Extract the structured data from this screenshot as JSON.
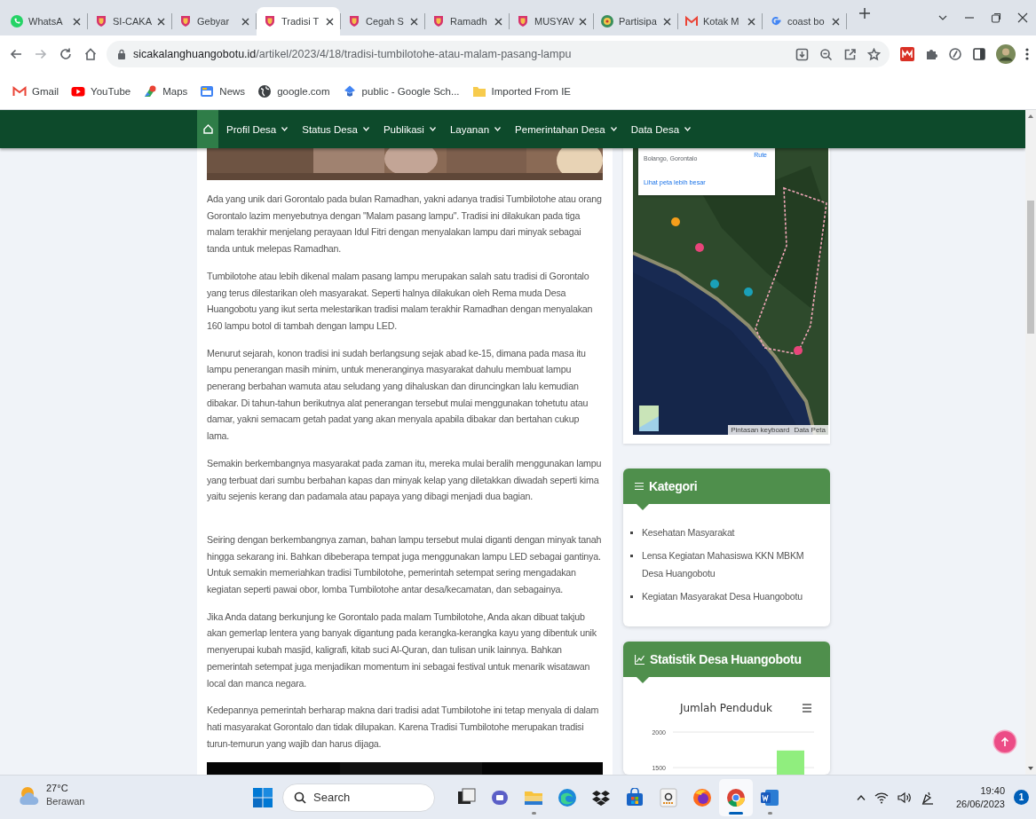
{
  "browser_tabs": [
    {
      "title": "WhatsA",
      "kind": "chat",
      "selected": false
    },
    {
      "title": "SI-CAKA",
      "kind": "crest",
      "selected": false
    },
    {
      "title": "Gebyar",
      "kind": "crest",
      "selected": false
    },
    {
      "title": "Tradisi T",
      "kind": "crest",
      "selected": true
    },
    {
      "title": "Cegah S",
      "kind": "crest",
      "selected": false
    },
    {
      "title": "Ramadh",
      "kind": "crest",
      "selected": false
    },
    {
      "title": "MUSYAV",
      "kind": "crest",
      "selected": false
    },
    {
      "title": "Partisipa",
      "kind": "emblem",
      "selected": false
    },
    {
      "title": "Kotak M",
      "kind": "mail",
      "selected": false
    },
    {
      "title": "coast bo",
      "kind": "search",
      "selected": false
    }
  ],
  "address_bar": {
    "url": "sicakalanghuangobotu.id/artikel/2023/4/18/tradisi-tumbilotohe-atau-malam-pasang-lampu"
  },
  "bookmarks": [
    {
      "label": "Gmail",
      "kind": "mail"
    },
    {
      "label": "YouTube",
      "kind": "video"
    },
    {
      "label": "Maps",
      "kind": "map"
    },
    {
      "label": "News",
      "kind": "news"
    },
    {
      "label": "google.com",
      "kind": "globe"
    },
    {
      "label": "public - Google Sch...",
      "kind": "cap"
    },
    {
      "label": "Imported From IE",
      "kind": "folder"
    }
  ],
  "site_nav": {
    "items": [
      {
        "label": "Profil Desa"
      },
      {
        "label": "Status Desa"
      },
      {
        "label": "Publikasi"
      },
      {
        "label": "Layanan"
      },
      {
        "label": "Pemerintahan Desa"
      },
      {
        "label": "Data Desa"
      }
    ]
  },
  "article": {
    "paragraphs": [
      {
        "text": "Ada yang unik dari Gorontalo pada bulan Ramadhan, yakni adanya tradisi Tumbilotohe atau orang Gorontalo lazim menyebutnya dengan \"Malam pasang lampu\". Tradisi ini dilakukan pada tiga malam terakhir menjelang perayaan Idul Fitri dengan menyalakan lampu dari minyak sebagai tanda untuk melepas Ramadhan.",
        "gap_before": false
      },
      {
        "text": "Tumbilotohe atau lebih dikenal malam pasang lampu merupakan salah satu tradisi di Gorontalo yang terus dilestarikan oleh masyarakat. Seperti halnya dilakukan oleh Rema muda Desa Huangobotu yang ikut serta melestarikan tradisi malam terakhir Ramadhan dengan menyalakan 160 lampu botol di tambah dengan lampu LED.",
        "gap_before": false
      },
      {
        "text": "Menurut sejarah, konon tradisi ini sudah berlangsung sejak abad ke-15, dimana pada masa itu lampu penerangan masih minim, untuk meneranginya masyarakat dahulu membuat lampu penerang berbahan wamuta atau seludang yang dihaluskan dan diruncingkan lalu kemudian dibakar. Di tahun-tahun berikutnya alat penerangan tersebut mulai menggunakan tohetutu atau damar, yakni semacam getah padat yang akan menyala apabila dibakar dan bertahan cukup lama.",
        "gap_before": false
      },
      {
        "text": "Semakin berkembangnya masyarakat pada zaman itu, mereka mulai beralih menggunakan lampu yang terbuat dari sumbu berbahan kapas dan minyak kelap yang diletakkan diwadah seperti kima yaitu sejenis kerang dan padamala atau papaya yang dibagi menjadi dua bagian.",
        "gap_before": false
      },
      {
        "text": "Seiring dengan berkembangnya zaman, bahan lampu tersebut mulai diganti dengan minyak tanah hingga sekarang ini. Bahkan dibeberapa tempat juga menggunakan lampu LED sebagai gantinya. Untuk semakin memeriahkan tradisi Tumbilotohe, pemerintah setempat sering mengadakan kegiatan seperti pawai obor, lomba Tumbilotohe antar desa/kecamatan, dan sebagainya.",
        "gap_before": true
      },
      {
        "text": "Jika Anda datang berkunjung ke Gorontalo pada malam Tumbilotohe, Anda akan dibuat takjub akan gemerlap lentera yang banyak digantung pada kerangka-kerangka kayu yang dibentuk unik menyerupai kubah masjid, kaligrafi, kitab suci Al-Quran, dan tulisan unik lainnya. Bahkan pemerintah setempat juga menjadikan momentum ini sebagai festival untuk menarik wisatawan local dan manca negara.",
        "gap_before": false
      },
      {
        "text": "Kedepannya pemerintah berharap makna dari tradisi adat Tumbilotohe ini tetap menyala di dalam hati masyarakat Gorontalo dan tidak dilupakan. Karena Tradisi Tumbilotohe merupakan tradisi turun-temurun yang wajib dan harus dijaga.",
        "gap_before": false
      }
    ]
  },
  "sidebar": {
    "map": {
      "place": "Bolango, Gorontalo",
      "directions": "Rute",
      "larger_map_link": "Lihat peta lebih besar",
      "attribution": [
        "Pintasan keyboard",
        "Data Peta"
      ]
    },
    "categories": {
      "title": "Kategori",
      "items": [
        "Kesehatan Masyarakat",
        "Lensa Kegiatan Mahasiswa KKN MBKM Desa Huangobotu",
        "Kegiatan Masyarakat Desa Huangobotu"
      ]
    },
    "statistics": {
      "title": "Statistik Desa Huangobotu",
      "chart_data": {
        "type": "bar",
        "title": "Jumlah Penduduk",
        "values": [
          1740
        ],
        "ylim": [
          1400,
          2000
        ],
        "yticks": [
          1500,
          2000
        ]
      }
    }
  },
  "taskbar": {
    "weather": {
      "temperature": "27°C",
      "condition": "Berawan"
    },
    "search": {
      "placeholder": "Search"
    },
    "apps": [
      {
        "kind": "terminal",
        "open": false,
        "active": false
      },
      {
        "kind": "meet",
        "open": false,
        "active": false
      },
      {
        "kind": "files",
        "open": true,
        "active": false
      },
      {
        "kind": "edge",
        "open": false,
        "active": false
      },
      {
        "kind": "dropbox",
        "open": false,
        "active": false
      },
      {
        "kind": "store",
        "open": false,
        "active": false
      },
      {
        "kind": "amazon",
        "open": false,
        "active": false
      },
      {
        "kind": "firefox",
        "open": false,
        "active": false
      },
      {
        "kind": "chrome",
        "open": true,
        "active": true
      },
      {
        "kind": "word",
        "open": true,
        "active": false
      }
    ],
    "time": "19:40",
    "date": "26/06/2023",
    "notifications": "1"
  }
}
